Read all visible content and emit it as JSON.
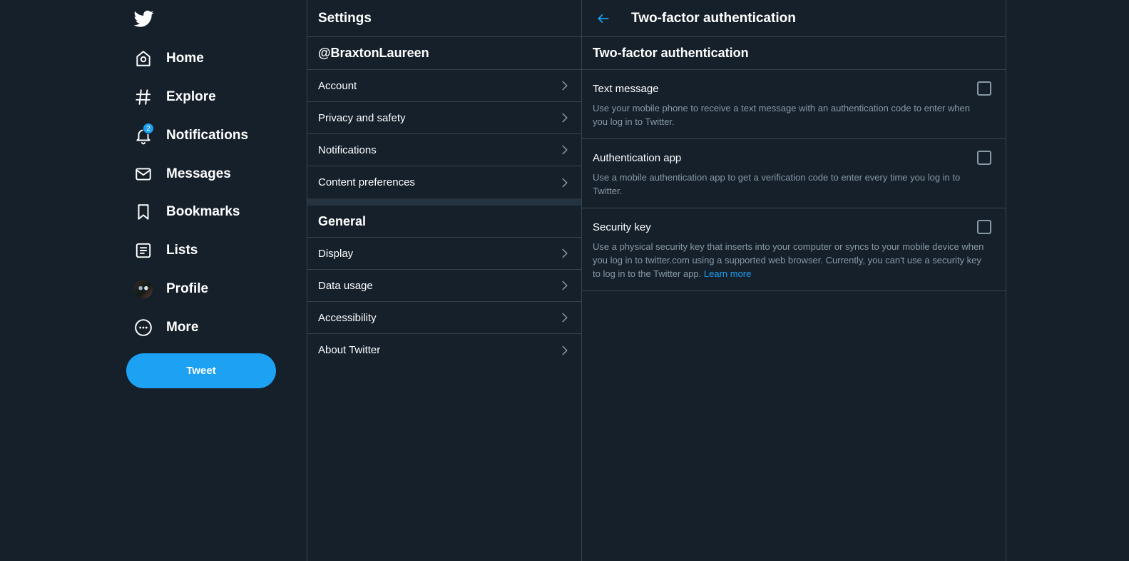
{
  "nav": {
    "items": [
      {
        "label": "Home",
        "icon": "home-icon"
      },
      {
        "label": "Explore",
        "icon": "hashtag-icon"
      },
      {
        "label": "Notifications",
        "icon": "bell-icon",
        "badge": "2"
      },
      {
        "label": "Messages",
        "icon": "envelope-icon"
      },
      {
        "label": "Bookmarks",
        "icon": "bookmark-icon"
      },
      {
        "label": "Lists",
        "icon": "list-icon"
      },
      {
        "label": "Profile",
        "icon": "avatar"
      },
      {
        "label": "More",
        "icon": "more-icon"
      }
    ],
    "tweet_label": "Tweet"
  },
  "settings": {
    "title": "Settings",
    "account_handle": "@BraxtonLaureen",
    "account_rows": [
      "Account",
      "Privacy and safety",
      "Notifications",
      "Content preferences"
    ],
    "general_title": "General",
    "general_rows": [
      "Display",
      "Data usage",
      "Accessibility",
      "About Twitter"
    ]
  },
  "twofa": {
    "header_title": "Two-factor authentication",
    "section_title": "Two-factor authentication",
    "options": [
      {
        "title": "Text message",
        "desc": "Use your mobile phone to receive a text message with an authentication code to enter when you log in to Twitter.",
        "checked": false
      },
      {
        "title": "Authentication app",
        "desc": "Use a mobile authentication app to get a verification code to enter every time you log in to Twitter.",
        "checked": false
      },
      {
        "title": "Security key",
        "desc": "Use a physical security key that inserts into your computer or syncs to your mobile device when you log in to twitter.com using a supported web browser. Currently, you can't use a security key to log in to the Twitter app.",
        "link": "Learn more",
        "checked": false
      }
    ]
  },
  "colors": {
    "background": "#15202b",
    "accent": "#1da1f2",
    "border": "#38444d",
    "muted": "#8899a6"
  }
}
